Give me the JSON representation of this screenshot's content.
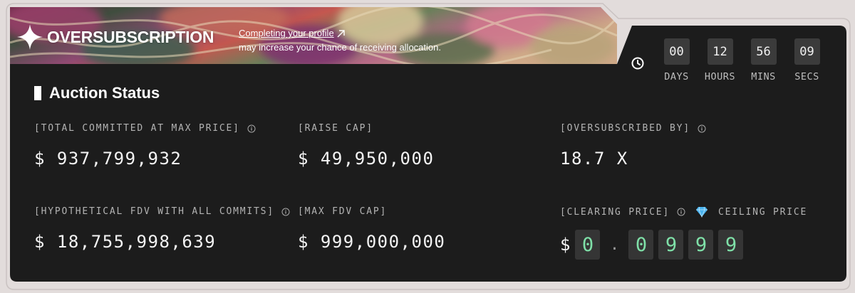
{
  "banner": {
    "title": "OVERSUBSCRIPTION",
    "promo_link": "Completing your profile",
    "promo_text": "may increase your chance of receiving allocation.",
    "sparkle_icon": "four-point-star-icon",
    "link_icon": "arrow-up-right-icon"
  },
  "countdown": {
    "clock_icon": "clock-icon",
    "units": [
      {
        "value": "00",
        "label": "DAYS"
      },
      {
        "value": "12",
        "label": "HOURS"
      },
      {
        "value": "56",
        "label": "MINS"
      },
      {
        "value": "09",
        "label": "SECS"
      }
    ]
  },
  "status": {
    "title": "Auction Status",
    "total_committed": {
      "label": "[TOTAL COMMITTED AT MAX PRICE]",
      "value": "$ 937,799,932"
    },
    "raise_cap": {
      "label": "[RAISE CAP]",
      "value": "$ 49,950,000"
    },
    "oversubscribed": {
      "label": "[OVERSUBSCRIBED BY]",
      "value": "18.7 X"
    },
    "hypothetical_fdv": {
      "label": "[HYPOTHETICAL FDV WITH ALL COMMITS]",
      "value": "$ 18,755,998,639"
    },
    "max_fdv_cap": {
      "label": "[MAX FDV CAP]",
      "value": "$ 999,000,000"
    },
    "clearing_price": {
      "label": "[CLEARING PRICE]",
      "ceiling_label": "CEILING PRICE",
      "ceiling_icon": "diamond-gem-icon",
      "currency": "$",
      "digits": [
        "0",
        ".",
        "0",
        "9",
        "9",
        "9"
      ]
    }
  },
  "colors": {
    "panel": "#1c1c1c",
    "digit_green": "#7fe0a8",
    "gem_blue": "#49b3ef",
    "background": "#e2dcdb"
  }
}
